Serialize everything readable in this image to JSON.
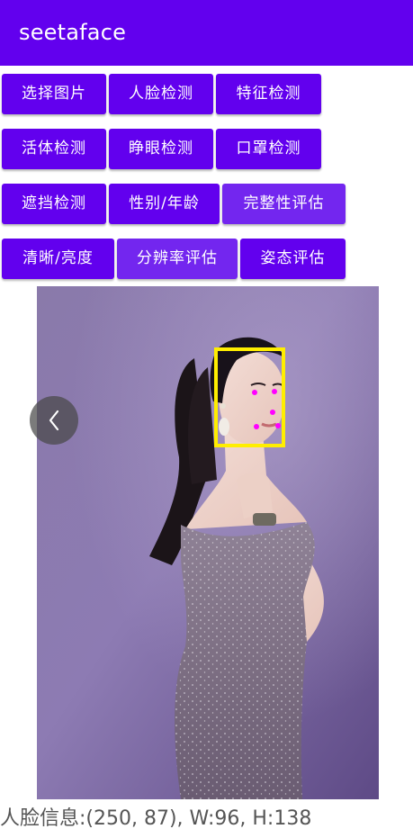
{
  "app_bar": {
    "title": "seetaface"
  },
  "buttons": {
    "select_image": "选择图片",
    "face_detect": "人脸检测",
    "landmark_detect": "特征检测",
    "liveness_detect": "活体检测",
    "eye_open_detect": "睁眼检测",
    "mask_detect": "口罩检测",
    "occlusion_detect": "遮挡检测",
    "gender_age": "性别/年龄",
    "integrity_eval": "完整性评估",
    "clarity_brightness": "清晰/亮度",
    "resolution_eval": "分辨率评估",
    "pose_eval": "姿态评估"
  },
  "colors": {
    "primary": "#6200ee",
    "face_box": "#ffee00",
    "landmark": "#ff00ff"
  },
  "icons": {
    "prev": "chevron-left-icon"
  },
  "face_info": {
    "text": "人脸信息:(250, 87), W:96, H:138"
  }
}
